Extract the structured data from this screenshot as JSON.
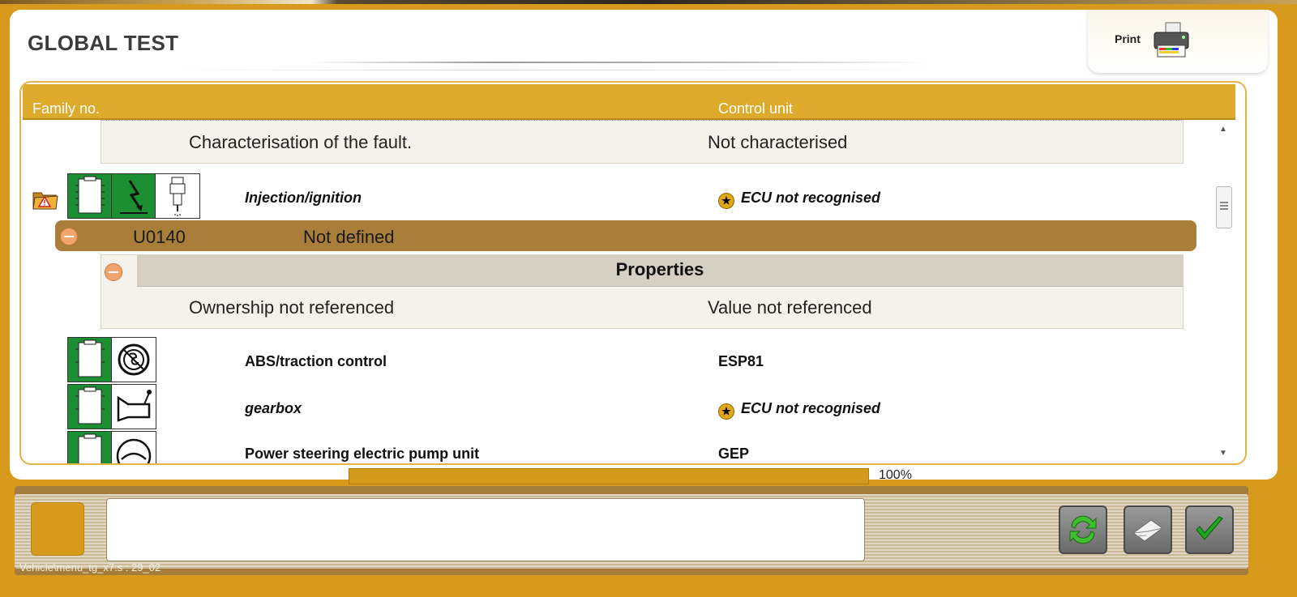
{
  "window": {
    "title": "GLOBAL TEST",
    "print_label": "Print"
  },
  "table": {
    "columns": [
      "Family no.",
      "Control unit"
    ]
  },
  "rows": {
    "characterisation": {
      "label": "Characterisation of the fault.",
      "value": "Not characterised"
    },
    "injection": {
      "name": "Injection/ignition",
      "ecu": "ECU not recognised"
    },
    "fault": {
      "code": "U0140",
      "description": "Not defined"
    },
    "properties": {
      "title": "Properties",
      "ownership": "Ownership not referenced",
      "value": "Value not referenced"
    },
    "abs": {
      "name": "ABS/traction control",
      "ecu": "ESP81"
    },
    "gearbox": {
      "name": "gearbox",
      "ecu": "ECU not recognised"
    },
    "power_steering": {
      "name": "Power steering electric pump unit",
      "ecu": "GEP"
    }
  },
  "progress": {
    "value_percent": 100,
    "label": "100%"
  },
  "status_bar": {
    "path": "Vehicle\\menu_tg_x7.s : 29_02"
  },
  "icons": {
    "folder_warning": "folder-warning-icon",
    "ecu": "ecu-module-icon",
    "ignition": "lightning-icon",
    "injector": "injector-icon",
    "abs": "abs-icon",
    "gearbox": "gearbox-icon",
    "steering": "steering-icon",
    "printer": "printer-icon",
    "refresh": "refresh-icon",
    "envelope": "envelope-icon",
    "checkmark": "checkmark-icon"
  },
  "colors": {
    "frame": "#d79a1c",
    "header": "#ddaa2c",
    "fault_row": "#a87e3a",
    "green": "#1c8f33"
  }
}
